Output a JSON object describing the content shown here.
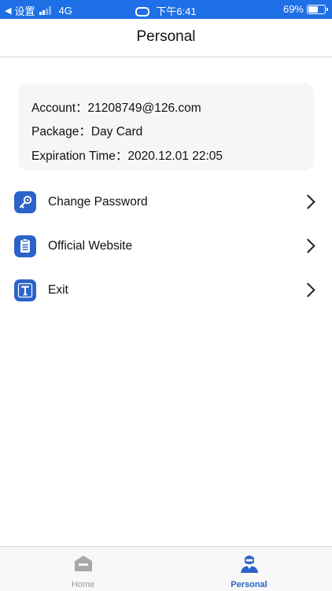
{
  "status_bar": {
    "back_glyph": "◀",
    "carrier": "设置",
    "network": "4G",
    "time": "下午6:41",
    "battery_percent": "69%",
    "battery_level": 0.69
  },
  "header": {
    "title": "Personal"
  },
  "account_card": {
    "account_label": "Account：",
    "account_value": "21208749@126.com",
    "package_label": "Package：",
    "package_value": "Day Card",
    "expiration_label": "Expiration Time：",
    "expiration_value": "2020.12.01 22:05"
  },
  "menu": {
    "items": [
      {
        "label": "Change Password",
        "icon": "key-icon"
      },
      {
        "label": "Official Website",
        "icon": "document-icon"
      },
      {
        "label": "Exit",
        "icon": "text-t-icon"
      }
    ]
  },
  "tab_bar": {
    "tabs": [
      {
        "label": "Home",
        "icon": "home-icon",
        "active": false
      },
      {
        "label": "Personal",
        "icon": "person-icon",
        "active": true
      }
    ]
  },
  "colors": {
    "status_bar": "#1f6fe6",
    "accent": "#2a63c9",
    "inactive_tab": "#9a9a9a"
  }
}
